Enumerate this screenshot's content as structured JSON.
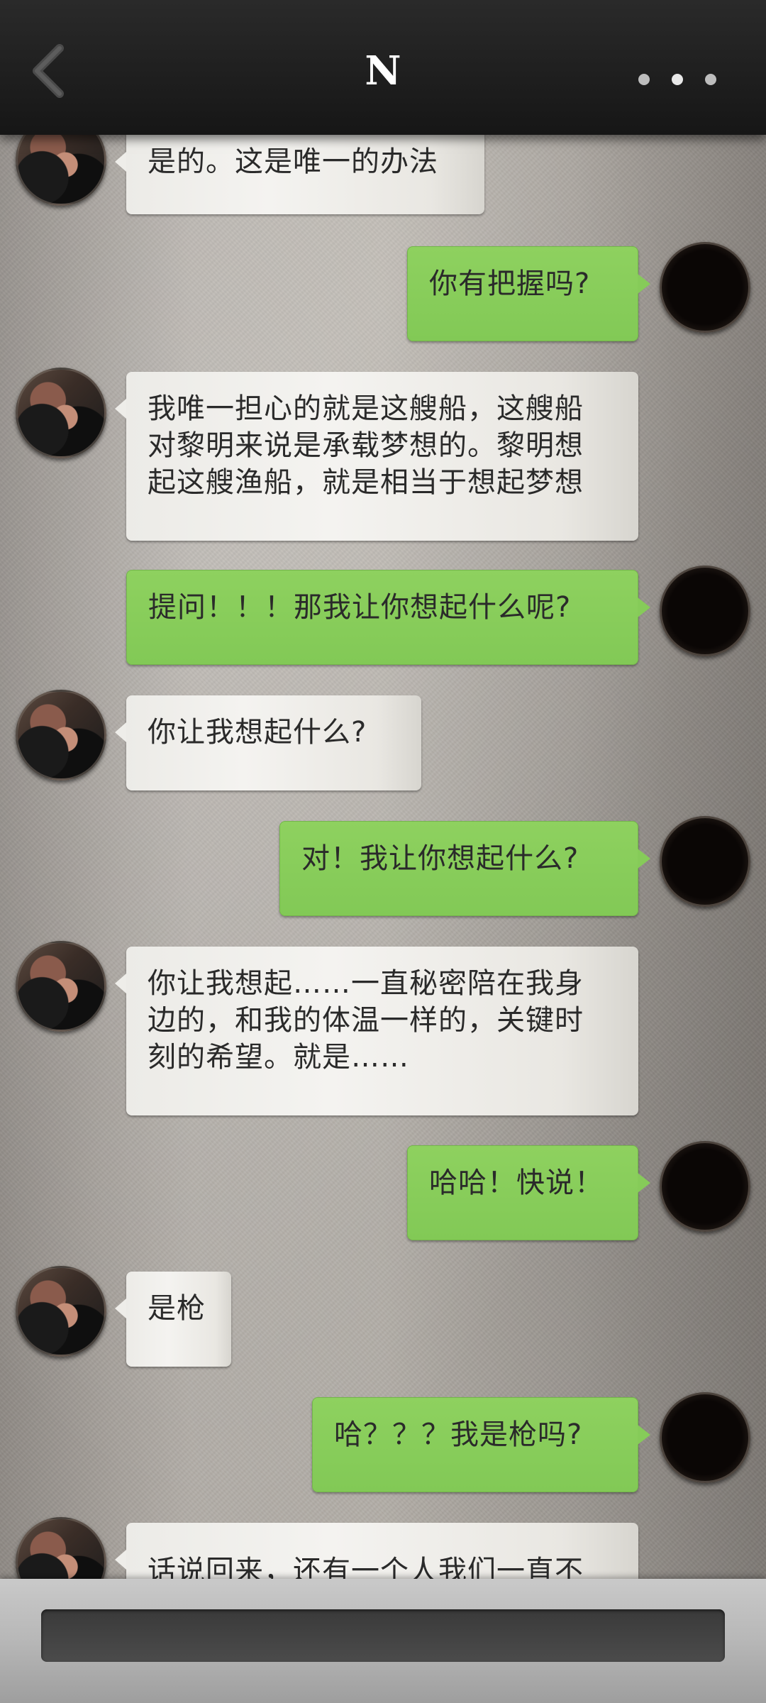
{
  "header": {
    "title": "N",
    "back_icon": "chevron-left-icon",
    "more_icon": "more-dots-icon"
  },
  "messages": [
    {
      "from": "other",
      "text": "是的。这是唯一的办法"
    },
    {
      "from": "self",
      "text": "你有把握吗?"
    },
    {
      "from": "other",
      "text": "我唯一担心的就是这艘船，这艘船\n对黎明来说是承载梦想的。黎明想\n起这艘渔船，就是相当于想起梦想"
    },
    {
      "from": "self",
      "text": "提问！！！那我让你想起什么呢?"
    },
    {
      "from": "other",
      "text": "你让我想起什么?"
    },
    {
      "from": "self",
      "text": "对！我让你想起什么?"
    },
    {
      "from": "other",
      "text": "你让我想起……一直秘密陪在我身\n边的，和我的体温一样的，关键时\n刻的希望。就是……"
    },
    {
      "from": "self",
      "text": "哈哈！快说！"
    },
    {
      "from": "other",
      "text": "是枪"
    },
    {
      "from": "self",
      "text": "哈？？？我是枪吗?"
    },
    {
      "from": "other",
      "text": "话说回来，还有一个人我们一直不"
    }
  ],
  "input": {
    "placeholder": ""
  },
  "colors": {
    "self_bubble": "#86cb59",
    "other_bubble": "#eeede9",
    "topbar": "#1e1e1e"
  }
}
